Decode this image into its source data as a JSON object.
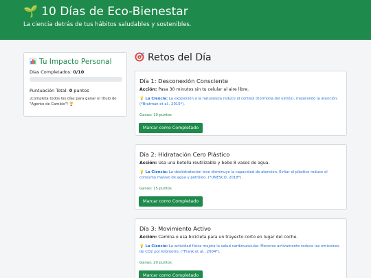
{
  "header": {
    "title": "10 Días de Eco-Bienestar",
    "subtitle": "La ciencia detrás de tus hábitos saludables y sostenibles."
  },
  "sidebar": {
    "title": "Tu Impacto Personal",
    "days_label": "Días Completados: ",
    "days_value": "0/10",
    "progress_fraction": 0,
    "score_label": "Puntuación Total: ",
    "score_value": "0",
    "score_unit": " puntos",
    "note": "¡Completa todos los días para ganar el título de \"Agente de Cambio\"! 🏆"
  },
  "main": {
    "title": "Retos del Día",
    "challenges": [
      {
        "title": "Día 1: Desconexión Consciente",
        "action_label": "Acción:",
        "action_text": " Pasa 30 minutos sin tu celular al aire libre.",
        "science_label": "La Ciencia:",
        "science_text": " La exposición a la naturaleza reduce el cortisol (hormona del estrés), mejorando la atención. (*Bratman et al., 2015*).",
        "points": "Ganas: 10 puntos",
        "button": "Marcar como Completado"
      },
      {
        "title": "Día 2: Hidratación Cero Plástico",
        "action_label": "Acción:",
        "action_text": " Usa una botella reutilizable y bebe 8 vasos de agua.",
        "science_label": "La Ciencia:",
        "science_text": " La deshidratación leve disminuye la capacidad de atención. Evitar el plástico reduce el consumo masivo de agua y petróleo. (*UNESCO, 2018*).",
        "points": "Ganas: 15 puntos",
        "button": "Marcar como Completado"
      },
      {
        "title": "Día 3: Movimiento Activo",
        "action_label": "Acción:",
        "action_text": " Camina o usa bicicleta para un trayecto corto en lugar del coche.",
        "science_label": "La Ciencia:",
        "science_text": " La actividad física mejora la salud cardiovascular. Moverse activamente reduce las emisiones de CO2 por kilómetro. (*Frank et al., 2004*).",
        "points": "Ganas: 20 puntos",
        "button": "Marcar como Completado"
      }
    ]
  },
  "colors": {
    "brand_green": "#1e8a4c",
    "science_blue": "#1f6fd6"
  },
  "icons": {
    "header": "sprout-icon",
    "sidebar": "bar-chart-icon",
    "main": "target-icon",
    "science": "lightbulb-icon"
  }
}
